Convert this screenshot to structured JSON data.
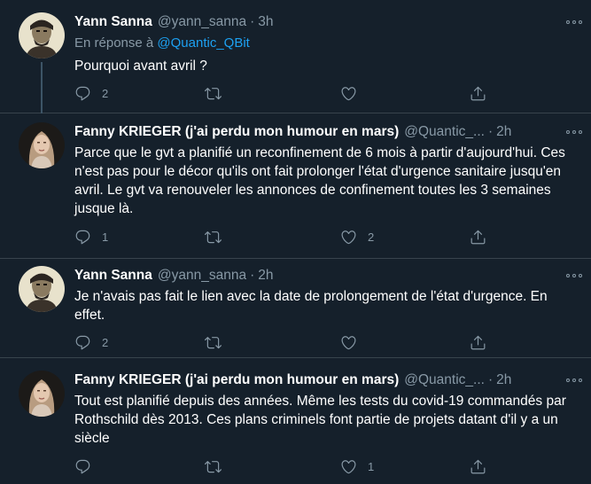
{
  "tweets": [
    {
      "name": "Yann Sanna",
      "handle": "@yann_sanna",
      "time": "3h",
      "reply_label": "En réponse à",
      "reply_to": "@Quantic_QBit",
      "text": "Pourquoi avant avril ?",
      "replies": "2",
      "retweets": "",
      "likes": ""
    },
    {
      "name": "Fanny KRIEGER (j'ai perdu mon humour en mars)",
      "handle": "@Quantic_...",
      "time": "2h",
      "text": "Parce que le gvt a planifié un reconfinement de 6 mois à partir d'aujourd'hui. Ces n'est pas pour le décor qu'ils ont fait prolonger l'état d'urgence sanitaire jusqu'en avril. Le gvt va renouveler les annonces de confinement toutes les 3 semaines jusque là.",
      "replies": "1",
      "retweets": "",
      "likes": "2"
    },
    {
      "name": "Yann Sanna",
      "handle": "@yann_sanna",
      "time": "2h",
      "text": "Je n'avais pas fait le lien avec la date de prolongement de l'état d'urgence. En effet.",
      "replies": "2",
      "retweets": "",
      "likes": ""
    },
    {
      "name": "Fanny KRIEGER (j'ai perdu mon humour en mars)",
      "handle": "@Quantic_...",
      "time": "2h",
      "text": "Tout est planifié depuis des années. Même les tests du covid-19 commandés par Rothschild dès 2013. Ces plans criminels font partie de projets datant d'il y a un siècle",
      "replies": "",
      "retweets": "",
      "likes": "1"
    }
  ],
  "separator": "·",
  "colors": {
    "background": "#15202b",
    "secondary_text": "#8899a6",
    "link": "#1da1f2",
    "divider": "#38444d"
  },
  "icons": [
    "reply-icon",
    "retweet-icon",
    "like-icon",
    "share-icon",
    "more-icon"
  ]
}
